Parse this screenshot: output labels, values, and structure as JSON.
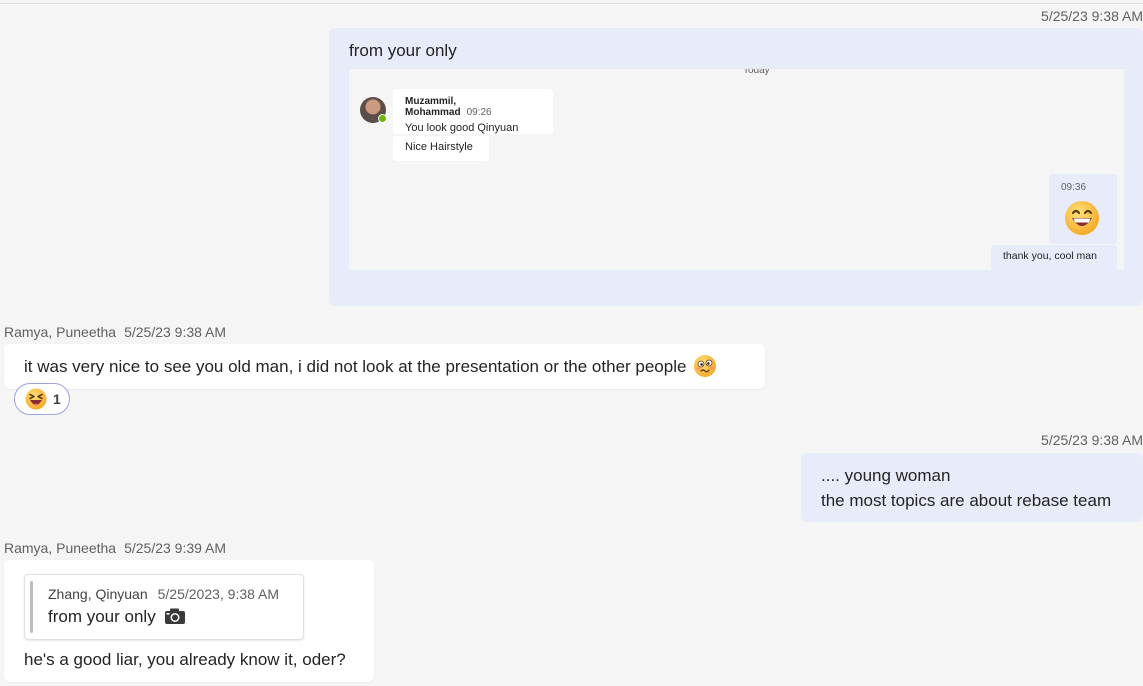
{
  "messages": {
    "m1": {
      "timestamp": "5/25/23 9:38 AM",
      "text": "from your only",
      "screenshot": {
        "today_label": "Today",
        "sender": "Muzammil, Mohammad",
        "time1": "09:26",
        "text1": "You look good Qinyuan",
        "text2": "Nice Hairstyle",
        "time2": "09:36",
        "text3": "thank you, cool man"
      }
    },
    "m2": {
      "sender": "Ramya, Puneetha",
      "timestamp": "5/25/23 9:38 AM",
      "text": "it was very nice to see you old man, i did not look at the presentation or the other people",
      "reaction_count": "1"
    },
    "m3": {
      "timestamp": "5/25/23 9:38 AM",
      "line1": ".... young woman",
      "line2": "the most topics are about rebase team"
    },
    "m4": {
      "sender": "Ramya, Puneetha",
      "timestamp": "5/25/23 9:39 AM",
      "quote": {
        "sender": "Zhang, Qinyuan",
        "timestamp": "5/25/2023, 9:38 AM",
        "text": "from your only"
      },
      "text": "he's a good liar, you already know it, oder?"
    }
  },
  "colors": {
    "background": "#f5f5f5",
    "my_bubble": "#e8ebfa",
    "other_bubble": "#ffffff",
    "reaction_border": "#9ea3e0",
    "presence": "#6bb700"
  },
  "icons": {
    "grin": "grinning-face-icon",
    "woozy": "woozy-face-icon",
    "laugh": "laughing-face-icon",
    "camera": "camera-icon"
  }
}
